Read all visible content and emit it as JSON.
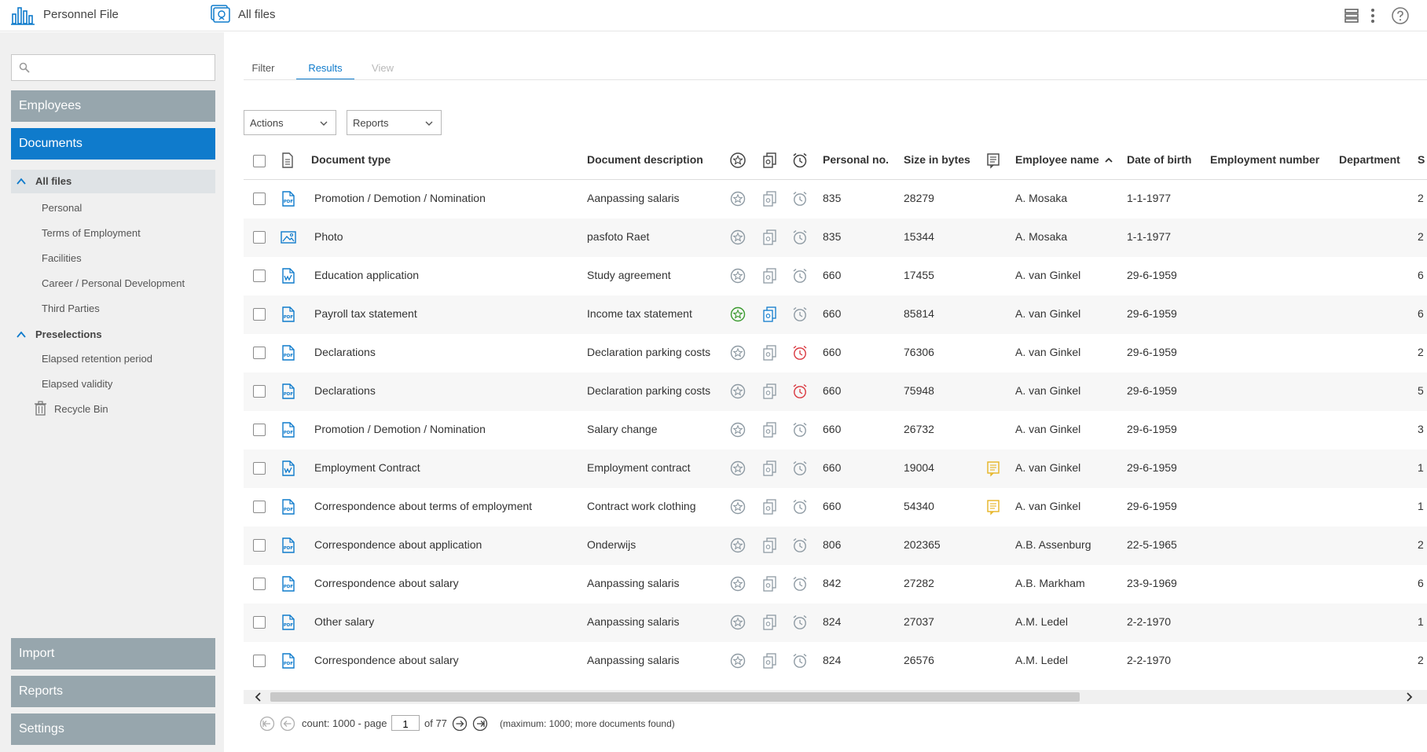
{
  "app": {
    "title": "Personnel File",
    "section_title": "All files"
  },
  "sidebar": {
    "search_placeholder": "",
    "nav_top": [
      {
        "label": "Employees",
        "active": false
      },
      {
        "label": "Documents",
        "active": true
      }
    ],
    "tree": {
      "all_files": {
        "label": "All files"
      },
      "all_files_children": [
        "Personal",
        "Terms of Employment",
        "Facilities",
        "Career / Personal Development",
        "Third Parties"
      ],
      "preselections": {
        "label": "Preselections"
      },
      "preselection_children": [
        "Elapsed retention period",
        "Elapsed validity"
      ],
      "recycle_bin": "Recycle Bin"
    },
    "nav_bottom": [
      "Import",
      "Reports",
      "Settings"
    ]
  },
  "tabs": [
    {
      "label": "Filter",
      "state": "normal"
    },
    {
      "label": "Results",
      "state": "active"
    },
    {
      "label": "View",
      "state": "disabled"
    }
  ],
  "toolbar": {
    "actions_label": "Actions",
    "reports_label": "Reports"
  },
  "table": {
    "headers": {
      "document_type": "Document type",
      "document_description": "Document description",
      "personal_no": "Personal no.",
      "size": "Size in bytes",
      "employee_name": "Employee name",
      "date_of_birth": "Date of birth",
      "employment_number": "Employment number",
      "department": "Department",
      "next": "S"
    },
    "sort_column": "employee_name",
    "rows": [
      {
        "file_icon": "pdf-icon",
        "doc_type": "Promotion / Demotion / Nomination",
        "desc": "Aanpassing salaris",
        "fav": false,
        "archived": false,
        "alarm": false,
        "personal_no": "835",
        "size": "28279",
        "note": false,
        "employee": "A. Mosaka",
        "dob": "1-1-1977",
        "emp_no": "",
        "dept": "",
        "next": "2"
      },
      {
        "file_icon": "image-icon",
        "doc_type": "Photo",
        "desc": "pasfoto Raet",
        "fav": false,
        "archived": false,
        "alarm": false,
        "personal_no": "835",
        "size": "15344",
        "note": false,
        "employee": "A. Mosaka",
        "dob": "1-1-1977",
        "emp_no": "",
        "dept": "",
        "next": "2"
      },
      {
        "file_icon": "signed-doc-icon",
        "doc_type": "Education application",
        "desc": "Study agreement",
        "fav": false,
        "archived": false,
        "alarm": false,
        "personal_no": "660",
        "size": "17455",
        "note": false,
        "employee": "A. van Ginkel",
        "dob": "29-6-1959",
        "emp_no": "",
        "dept": "",
        "next": "6"
      },
      {
        "file_icon": "pdf-icon",
        "doc_type": "Payroll tax statement",
        "desc": "Income tax statement",
        "fav": true,
        "archived": true,
        "alarm": false,
        "personal_no": "660",
        "size": "85814",
        "note": false,
        "employee": "A. van Ginkel",
        "dob": "29-6-1959",
        "emp_no": "",
        "dept": "",
        "next": "6"
      },
      {
        "file_icon": "pdf-icon",
        "doc_type": "Declarations",
        "desc": "Declaration parking costs",
        "fav": false,
        "archived": false,
        "alarm": true,
        "personal_no": "660",
        "size": "76306",
        "note": false,
        "employee": "A. van Ginkel",
        "dob": "29-6-1959",
        "emp_no": "",
        "dept": "",
        "next": "2"
      },
      {
        "file_icon": "pdf-icon",
        "doc_type": "Declarations",
        "desc": "Declaration parking costs",
        "fav": false,
        "archived": false,
        "alarm": true,
        "personal_no": "660",
        "size": "75948",
        "note": false,
        "employee": "A. van Ginkel",
        "dob": "29-6-1959",
        "emp_no": "",
        "dept": "",
        "next": "5"
      },
      {
        "file_icon": "pdf-icon",
        "doc_type": "Promotion / Demotion / Nomination",
        "desc": "Salary change",
        "fav": false,
        "archived": false,
        "alarm": false,
        "personal_no": "660",
        "size": "26732",
        "note": false,
        "employee": "A. van Ginkel",
        "dob": "29-6-1959",
        "emp_no": "",
        "dept": "",
        "next": "3"
      },
      {
        "file_icon": "signed-doc-icon",
        "doc_type": "Employment Contract",
        "desc": "Employment contract",
        "fav": false,
        "archived": false,
        "alarm": false,
        "personal_no": "660",
        "size": "19004",
        "note": true,
        "employee": "A. van Ginkel",
        "dob": "29-6-1959",
        "emp_no": "",
        "dept": "",
        "next": "1"
      },
      {
        "file_icon": "pdf-icon",
        "doc_type": "Correspondence about terms of employment",
        "desc": "Contract work clothing",
        "fav": false,
        "archived": false,
        "alarm": false,
        "personal_no": "660",
        "size": "54340",
        "note": true,
        "employee": "A. van Ginkel",
        "dob": "29-6-1959",
        "emp_no": "",
        "dept": "",
        "next": "1"
      },
      {
        "file_icon": "pdf-icon",
        "doc_type": "Correspondence about application",
        "desc": "Onderwijs",
        "fav": false,
        "archived": false,
        "alarm": false,
        "personal_no": "806",
        "size": "202365",
        "note": false,
        "employee": "A.B. Assenburg",
        "dob": "22-5-1965",
        "emp_no": "",
        "dept": "",
        "next": "2"
      },
      {
        "file_icon": "pdf-icon",
        "doc_type": "Correspondence about salary",
        "desc": "Aanpassing salaris",
        "fav": false,
        "archived": false,
        "alarm": false,
        "personal_no": "842",
        "size": "27282",
        "note": false,
        "employee": "A.B. Markham",
        "dob": "23-9-1969",
        "emp_no": "",
        "dept": "",
        "next": "6"
      },
      {
        "file_icon": "pdf-icon",
        "doc_type": "Other salary",
        "desc": "Aanpassing salaris",
        "fav": false,
        "archived": false,
        "alarm": false,
        "personal_no": "824",
        "size": "27037",
        "note": false,
        "employee": "A.M. Ledel",
        "dob": "2-2-1970",
        "emp_no": "",
        "dept": "",
        "next": "1"
      },
      {
        "file_icon": "pdf-icon",
        "doc_type": "Correspondence about salary",
        "desc": "Aanpassing salaris",
        "fav": false,
        "archived": false,
        "alarm": false,
        "personal_no": "824",
        "size": "26576",
        "note": false,
        "employee": "A.M. Ledel",
        "dob": "2-2-1970",
        "emp_no": "",
        "dept": "",
        "next": "2"
      }
    ]
  },
  "pager": {
    "count_label": "count: 1000 - page",
    "page": "1",
    "of_label": "of 77",
    "note": "(maximum: 1000; more documents found)"
  },
  "colors": {
    "accent": "#0f7bcc",
    "nav_gray": "#97a6ad",
    "icon_gray": "#8e9aa3",
    "fav_green": "#3a9a2e",
    "alarm_red": "#d9363e",
    "note_yellow": "#e6b422"
  }
}
